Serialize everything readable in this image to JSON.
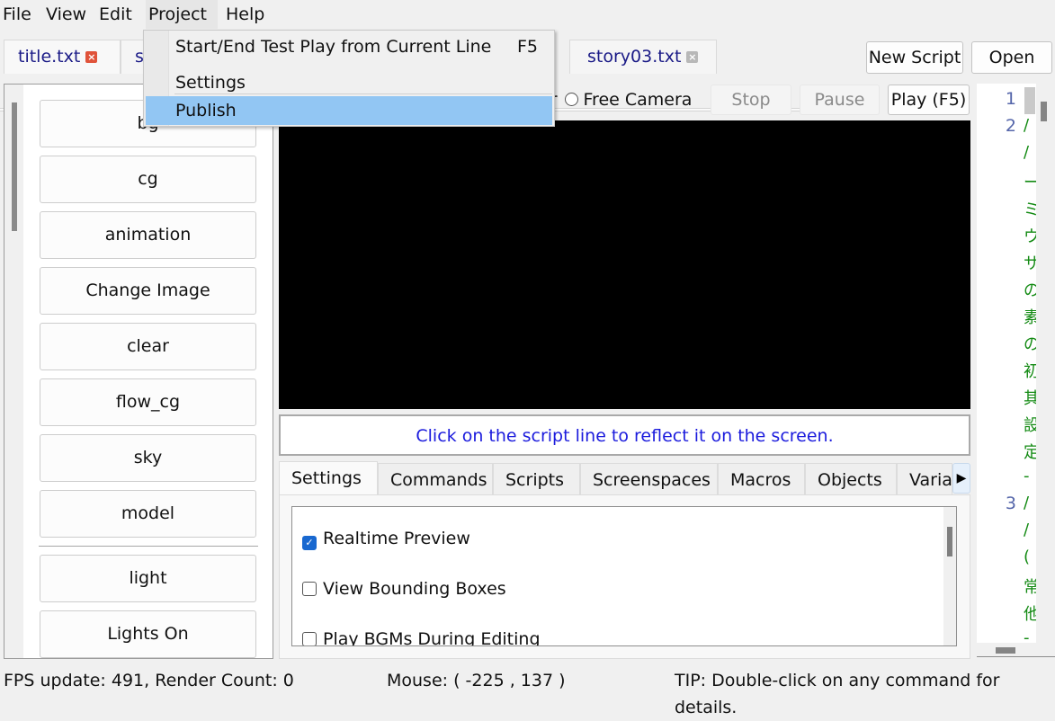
{
  "menubar": {
    "items": [
      {
        "label": "File"
      },
      {
        "label": "View"
      },
      {
        "label": "Edit"
      },
      {
        "label": "Project",
        "open": true
      },
      {
        "label": "Help"
      }
    ]
  },
  "project_menu": {
    "items": [
      {
        "label": "Start/End Test Play from Current Line",
        "shortcut": "F5"
      },
      {
        "label": "Settings"
      },
      {
        "label": "Publish",
        "highlighted": true
      }
    ]
  },
  "file_tabs": [
    {
      "label": "title.txt",
      "active": true,
      "close_style": "red"
    },
    {
      "label": "s",
      "active": false
    },
    {
      "label": "story03.txt",
      "active": false,
      "close_style": "gray"
    }
  ],
  "toolbar": {
    "new_script": "New Script",
    "open": "Open",
    "camera_mode_partial": "er",
    "free_camera": "Free Camera",
    "stop": "Stop",
    "pause": "Pause",
    "play": "Play (F5)"
  },
  "command_buttons": [
    "bg",
    "cg",
    "animation",
    "Change Image",
    "clear",
    "flow_cg",
    "sky",
    "model"
  ],
  "command_buttons_2": [
    "light",
    "Lights On"
  ],
  "preview": {
    "hint": "Click on the script line to reflect it on the screen."
  },
  "bottom_tabs": [
    {
      "label": "Settings",
      "active": true
    },
    {
      "label": "Commands"
    },
    {
      "label": "Scripts"
    },
    {
      "label": "Screenspaces"
    },
    {
      "label": "Macros"
    },
    {
      "label": "Objects"
    },
    {
      "label": "Varia"
    }
  ],
  "settings": {
    "options": [
      {
        "label": "Realtime Preview",
        "checked": true
      },
      {
        "label": "View Bounding Boxes",
        "checked": false
      },
      {
        "label": "Play BGMs During Editing",
        "checked": false
      }
    ]
  },
  "code": {
    "line_numbers": [
      "1",
      "2",
      "3"
    ],
    "visible_chars": [
      "/",
      "/",
      "ー",
      "ミ",
      "ウ",
      "サ",
      "の",
      "素",
      "の",
      "初",
      "其",
      "設",
      "定",
      "-",
      "/",
      "/",
      "(",
      "常",
      "他",
      "-"
    ]
  },
  "status": {
    "fps": "FPS update: 491, Render Count: 0",
    "mouse": "Mouse: ( -225 , 137 )",
    "tip": "TIP: Double-click on any command for details."
  },
  "colors": {
    "menu_highlight": "#92c6f3",
    "tab_text": "#1b1b87",
    "hint_text": "#1b1bdd",
    "code_text": "#138a13",
    "checkbox_on": "#1868d0"
  }
}
